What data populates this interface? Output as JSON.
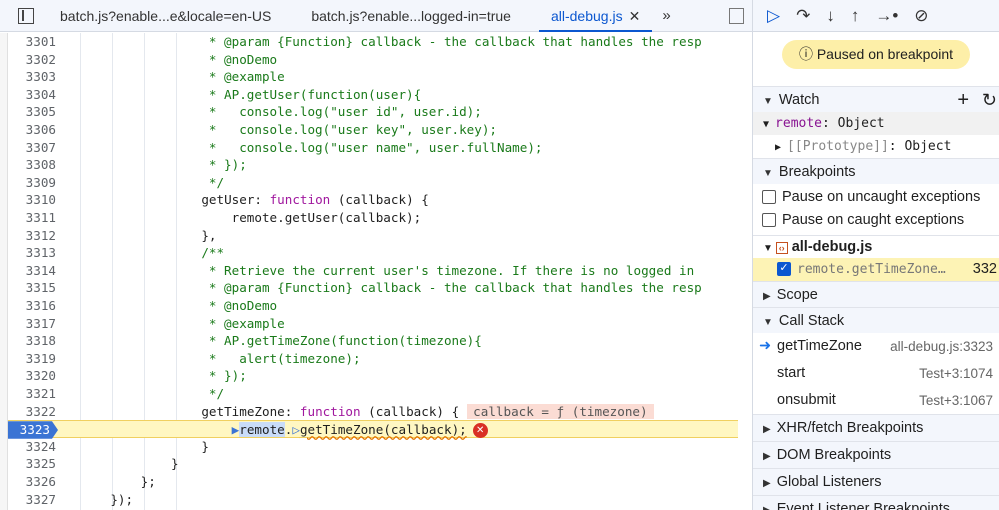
{
  "tabs": [
    "batch.js?enable...e&locale=en-US",
    "batch.js?enable...logged-in=true",
    "all-debug.js"
  ],
  "code": [
    {
      "n": "3301",
      "t": "                 * @param {Function} callback - the callback that handles the resp",
      "cls": "c"
    },
    {
      "n": "3302",
      "t": "                 * @noDemo",
      "cls": "c"
    },
    {
      "n": "3303",
      "t": "                 * @example",
      "cls": "c"
    },
    {
      "n": "3304",
      "t": "                 * AP.getUser(function(user){",
      "cls": "c"
    },
    {
      "n": "3305",
      "t": "                 *   console.log(\"user id\", user.id);",
      "cls": "c"
    },
    {
      "n": "3306",
      "t": "                 *   console.log(\"user key\", user.key);",
      "cls": "c"
    },
    {
      "n": "3307",
      "t": "                 *   console.log(\"user name\", user.fullName);",
      "cls": "c"
    },
    {
      "n": "3308",
      "t": "                 * });",
      "cls": "c"
    },
    {
      "n": "3309",
      "t": "                 */",
      "cls": "c"
    },
    {
      "n": "3310",
      "t": "getUser",
      "fn": true
    },
    {
      "n": "3311",
      "t": "                    remote.getUser(callback);"
    },
    {
      "n": "3312",
      "t": "                },"
    },
    {
      "n": "3313",
      "t": "                /**",
      "cls": "c"
    },
    {
      "n": "3314",
      "t": "                 * Retrieve the current user's timezone. If there is no logged in",
      "cls": "c"
    },
    {
      "n": "3315",
      "t": "                 * @param {Function} callback - the callback that handles the resp",
      "cls": "c"
    },
    {
      "n": "3316",
      "t": "                 * @noDemo",
      "cls": "c"
    },
    {
      "n": "3317",
      "t": "                 * @example",
      "cls": "c"
    },
    {
      "n": "3318",
      "t": "                 * AP.getTimeZone(function(timezone){",
      "cls": "c"
    },
    {
      "n": "3319",
      "t": "                 *   alert(timezone);",
      "cls": "c"
    },
    {
      "n": "3320",
      "t": "                 * });",
      "cls": "c"
    },
    {
      "n": "3321",
      "t": "                 */",
      "cls": "c"
    },
    {
      "n": "3322",
      "t": "getTimeZone",
      "fn": true
    },
    {
      "n": "3323",
      "t": "",
      "cur": true
    },
    {
      "n": "3324",
      "t": "                }"
    },
    {
      "n": "3325",
      "t": "            }"
    },
    {
      "n": "3326",
      "t": "        };"
    },
    {
      "n": "3327",
      "t": "    });"
    }
  ],
  "fn_keyword": "function",
  "fn_param": "(callback) {",
  "inline_value": "callback = ƒ (timezone)",
  "cur_line": {
    "obj": "remote",
    "dot": ".",
    "call": "getTimeZone(callback);"
  },
  "paused": "Paused on breakpoint",
  "watch": {
    "title": "Watch",
    "expr": "remote",
    "value": ": Object",
    "proto": "[[Prototype]]",
    "proto_value": ": Object"
  },
  "breakpoints": {
    "title": "Breakpoints",
    "uncaught": "Pause on uncaught exceptions",
    "caught": "Pause on caught exceptions",
    "file": "all-debug.js",
    "bp_text": "remote.getTimeZone…",
    "bp_line": "332"
  },
  "scope": "Scope",
  "call_stack": {
    "title": "Call Stack",
    "frames": [
      {
        "name": "getTimeZone",
        "loc": "all-debug.js:3323"
      },
      {
        "name": "start",
        "loc": "Test+3:1074"
      },
      {
        "name": "onsubmit",
        "loc": "Test+3:1067"
      }
    ]
  },
  "sections": [
    "XHR/fetch Breakpoints",
    "DOM Breakpoints",
    "Global Listeners",
    "Event Listener Breakpoints"
  ]
}
